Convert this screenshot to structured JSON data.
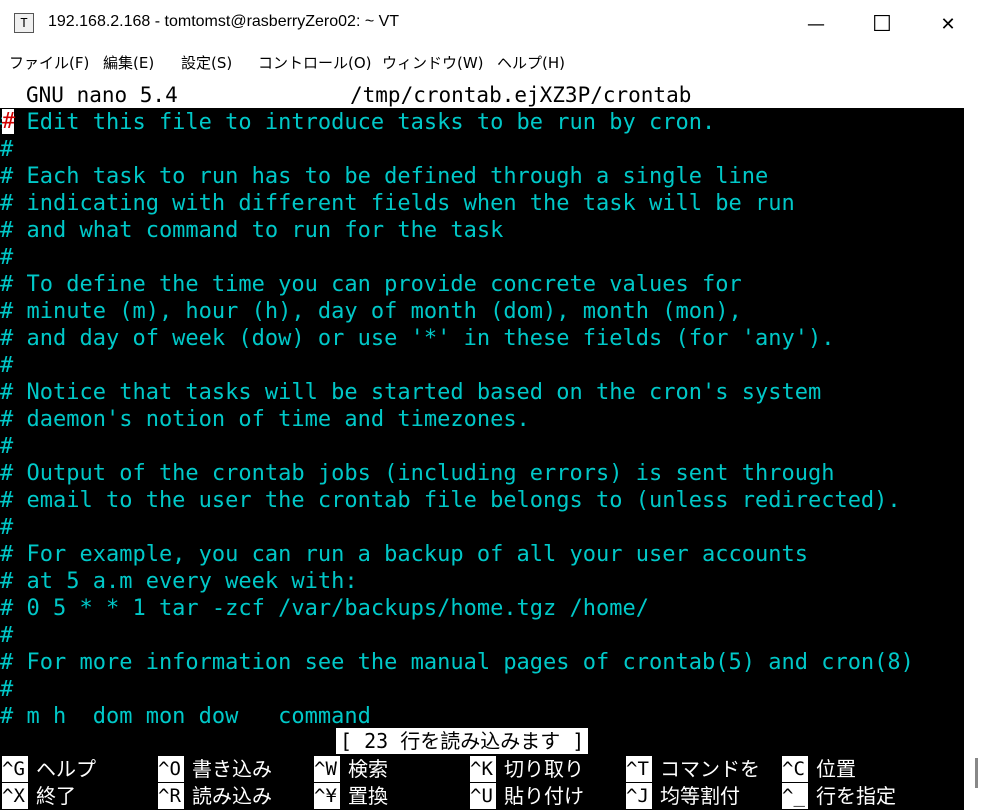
{
  "window": {
    "title": "192.168.2.168 - tomtomst@rasberryZero02: ~ VT",
    "app_icon": "T",
    "minimize_icon": "—",
    "maximize_icon": "☐",
    "close_icon": "✕"
  },
  "menu": [
    "ファイル(F)",
    "編集(E)",
    "設定(S)",
    "コントロール(O)",
    "ウィンドウ(W)",
    "ヘルプ(H)"
  ],
  "nano": {
    "version": "GNU nano 5.4",
    "filename": "/tmp/crontab.ejXZ3P/crontab",
    "cursor_char": "#",
    "lines": [
      "# Edit this file to introduce tasks to be run by cron.",
      "#",
      "# Each task to run has to be defined through a single line",
      "# indicating with different fields when the task will be run",
      "# and what command to run for the task",
      "#",
      "# To define the time you can provide concrete values for",
      "# minute (m), hour (h), day of month (dom), month (mon),",
      "# and day of week (dow) or use '*' in these fields (for 'any').",
      "#",
      "# Notice that tasks will be started based on the cron's system",
      "# daemon's notion of time and timezones.",
      "#",
      "# Output of the crontab jobs (including errors) is sent through",
      "# email to the user the crontab file belongs to (unless redirected).",
      "#",
      "# For example, you can run a backup of all your user accounts",
      "# at 5 a.m every week with:",
      "# 0 5 * * 1 tar -zcf /var/backups/home.tgz /home/",
      "#",
      "# For more information see the manual pages of crontab(5) and cron(8)",
      "#",
      "# m h  dom mon dow   command"
    ],
    "status": "[ 23 行を読み込みます ]",
    "shortcuts_row1": [
      {
        "key": "^G",
        "label": "ヘルプ"
      },
      {
        "key": "^O",
        "label": "書き込み"
      },
      {
        "key": "^W",
        "label": "検索"
      },
      {
        "key": "^K",
        "label": "切り取り"
      },
      {
        "key": "^T",
        "label": "コマンドを"
      },
      {
        "key": "^C",
        "label": "位置"
      }
    ],
    "shortcuts_row2": [
      {
        "key": "^X",
        "label": "終了"
      },
      {
        "key": "^R",
        "label": "読み込み"
      },
      {
        "key": "^¥",
        "label": "置換"
      },
      {
        "key": "^U",
        "label": "貼り付け"
      },
      {
        "key": "^J",
        "label": "均等割付"
      },
      {
        "key": "^_",
        "label": "行を指定"
      }
    ]
  }
}
